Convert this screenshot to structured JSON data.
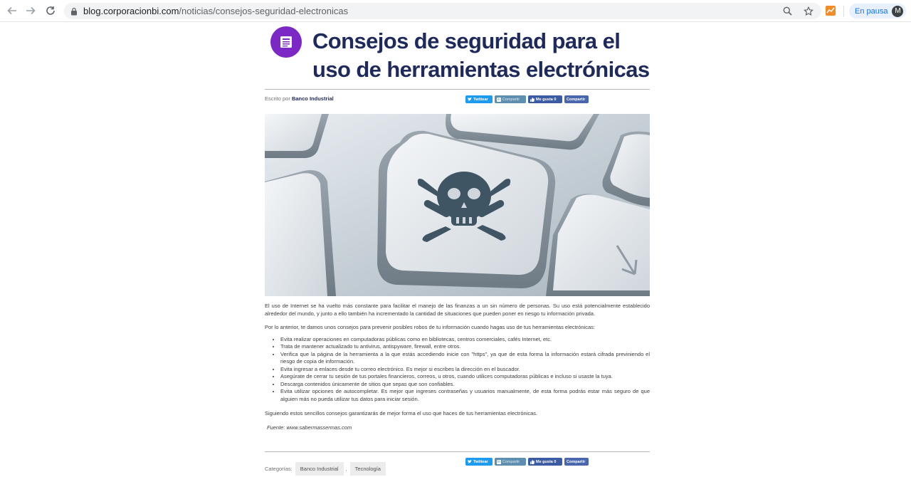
{
  "browser": {
    "url_domain": "blog.corporacionbi.com",
    "url_path": "/noticias/consejos-seguridad-electronicas",
    "profile_status": "En pausa",
    "profile_initial": "M",
    "icons": [
      "back-arrow-icon",
      "forward-arrow-icon",
      "reload-icon",
      "lock-icon",
      "zoom-icon",
      "star-icon",
      "extension-icon"
    ]
  },
  "article": {
    "title": "Consejos de seguridad para el uso de herramientas electrónicas",
    "category_icon": "newspaper-icon",
    "category_icon_color": "#7b28c4",
    "byline_prefix": "Escrito por",
    "author": "Banco Industrial",
    "share": {
      "twitter": "Twittear",
      "linkedin": "Compartir",
      "facebook_like": "Me gusta 0",
      "facebook_share": "Compartir"
    },
    "hero_image_description_icon": "skull-key-icon",
    "paragraph_1": "El uso de Internet se ha vuelto más constante para facilitar el manejo de las finanzas a un sin número de personas. Su uso está potencialmente establecido alrededor del mundo, y junto a ello también ha incrementado la cantidad de situaciones que pueden poner en riesgo tu información privada.",
    "paragraph_2": "Por lo anterior, te damos unos consejos para prevenir posibles robos de tu información cuando hagas uso de tus herramientas electrónicas:",
    "tips": [
      "Evita realizar operaciones en computadoras públicas como en bibliotecas, centros comerciales, cafés Internet, etc.",
      "Trata de mantener actualizado tu antivirus, antispyware, firewall, entre otros.",
      "Verifica que la página de la herramienta a la que estás accediendo inicie con \"https\", ya que de esta forma la información estará cifrada previniendo el riesgo de copia de información.",
      "Evita ingresar a enlaces desde tu correo electrónico. Es mejor si escribes la dirección en el buscador.",
      "Asegúrate de cerrar tu sesión de tus portales financieros, correos, u otros, cuando utilices computadoras públicas e incluso si usaste la tuya.",
      "Descarga contenidos únicamente de sitios que sepas que son confiables.",
      "Evita utilizar opciones de autocompletar. Es mejor que ingreses contraseñas y usuarios manualmente, de esta forma podrás estar más seguro de que alguien más no pueda utilizar tus datos para iniciar sesión."
    ],
    "paragraph_3": "Siguiendo estos sencillos consejos garantizarás de mejor forma el uso que haces de tus herramientas electrónicas.",
    "source": "Fuente: www.sabermassermas.com",
    "categories_label": "Categorías:",
    "categories": [
      "Banco Industrial",
      "Tecnología"
    ],
    "category_separator": ","
  }
}
